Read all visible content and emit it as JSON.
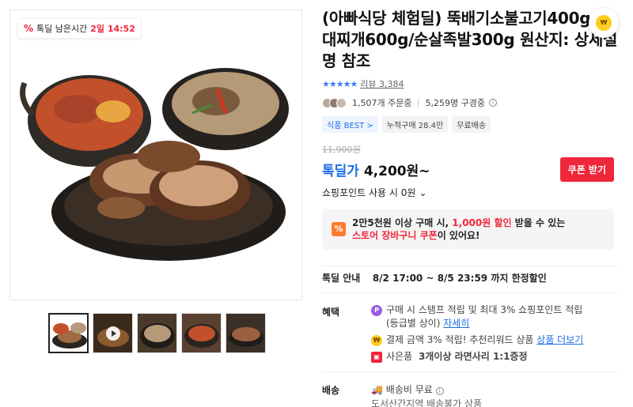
{
  "timer": {
    "label": "톡딜 남은시간",
    "time": "2일 14:52"
  },
  "title": "(아빠식당 체험딜) 뚝배기소불고기400g/부대찌개600g/순살족발300g 원산지: 상세설명 참조",
  "rating": {
    "stars": "★★★★★",
    "reviews": "리뷰 3,384"
  },
  "buyers": {
    "orders": "1,507개 주문중",
    "subscribers": "5,259명 구경중"
  },
  "tags": [
    "식품 BEST >",
    "누적구매 28.4만",
    "무료배송"
  ],
  "price": {
    "original": "11,900원",
    "label": "톡딜가",
    "amount": "4,200원~",
    "coupon_button": "쿠폰 받기",
    "points_text": "쇼핑포인트 사용 시 0원"
  },
  "promo": {
    "line1_a": "2만5천원 이상 구매 시, ",
    "line1_hl": "1,000원 할인",
    "line1_b": " 받을 수 있는",
    "line2_hl": "스토어 장바구니 쿠폰",
    "line2_b": "이 있어요!"
  },
  "deal": {
    "label": "톡딜 안내",
    "text": "8/2 17:00 ~ 8/5 23:59 까지 한정할인"
  },
  "benefits": {
    "label": "혜택",
    "item1": "구매 시 스탬프 적립 및 최대 3% 쇼핑포인트 적립",
    "item1_sub": "(등급별 상이)",
    "item1_link": "자세히",
    "item2": "결제 금액 3% 적립! 추천리워드 상품",
    "item2_link": "상품 더보기",
    "item3_a": "사은품",
    "item3_b": "3개이상 라면사리 1:1증정"
  },
  "shipping": {
    "label": "배송",
    "fee": "배송비 무료",
    "note": "도서산간지역 배송불가 상품"
  },
  "colors": {
    "accent_red": "#f0263a",
    "accent_blue": "#1f6ee8",
    "promo_orange": "#ff7a2f"
  }
}
